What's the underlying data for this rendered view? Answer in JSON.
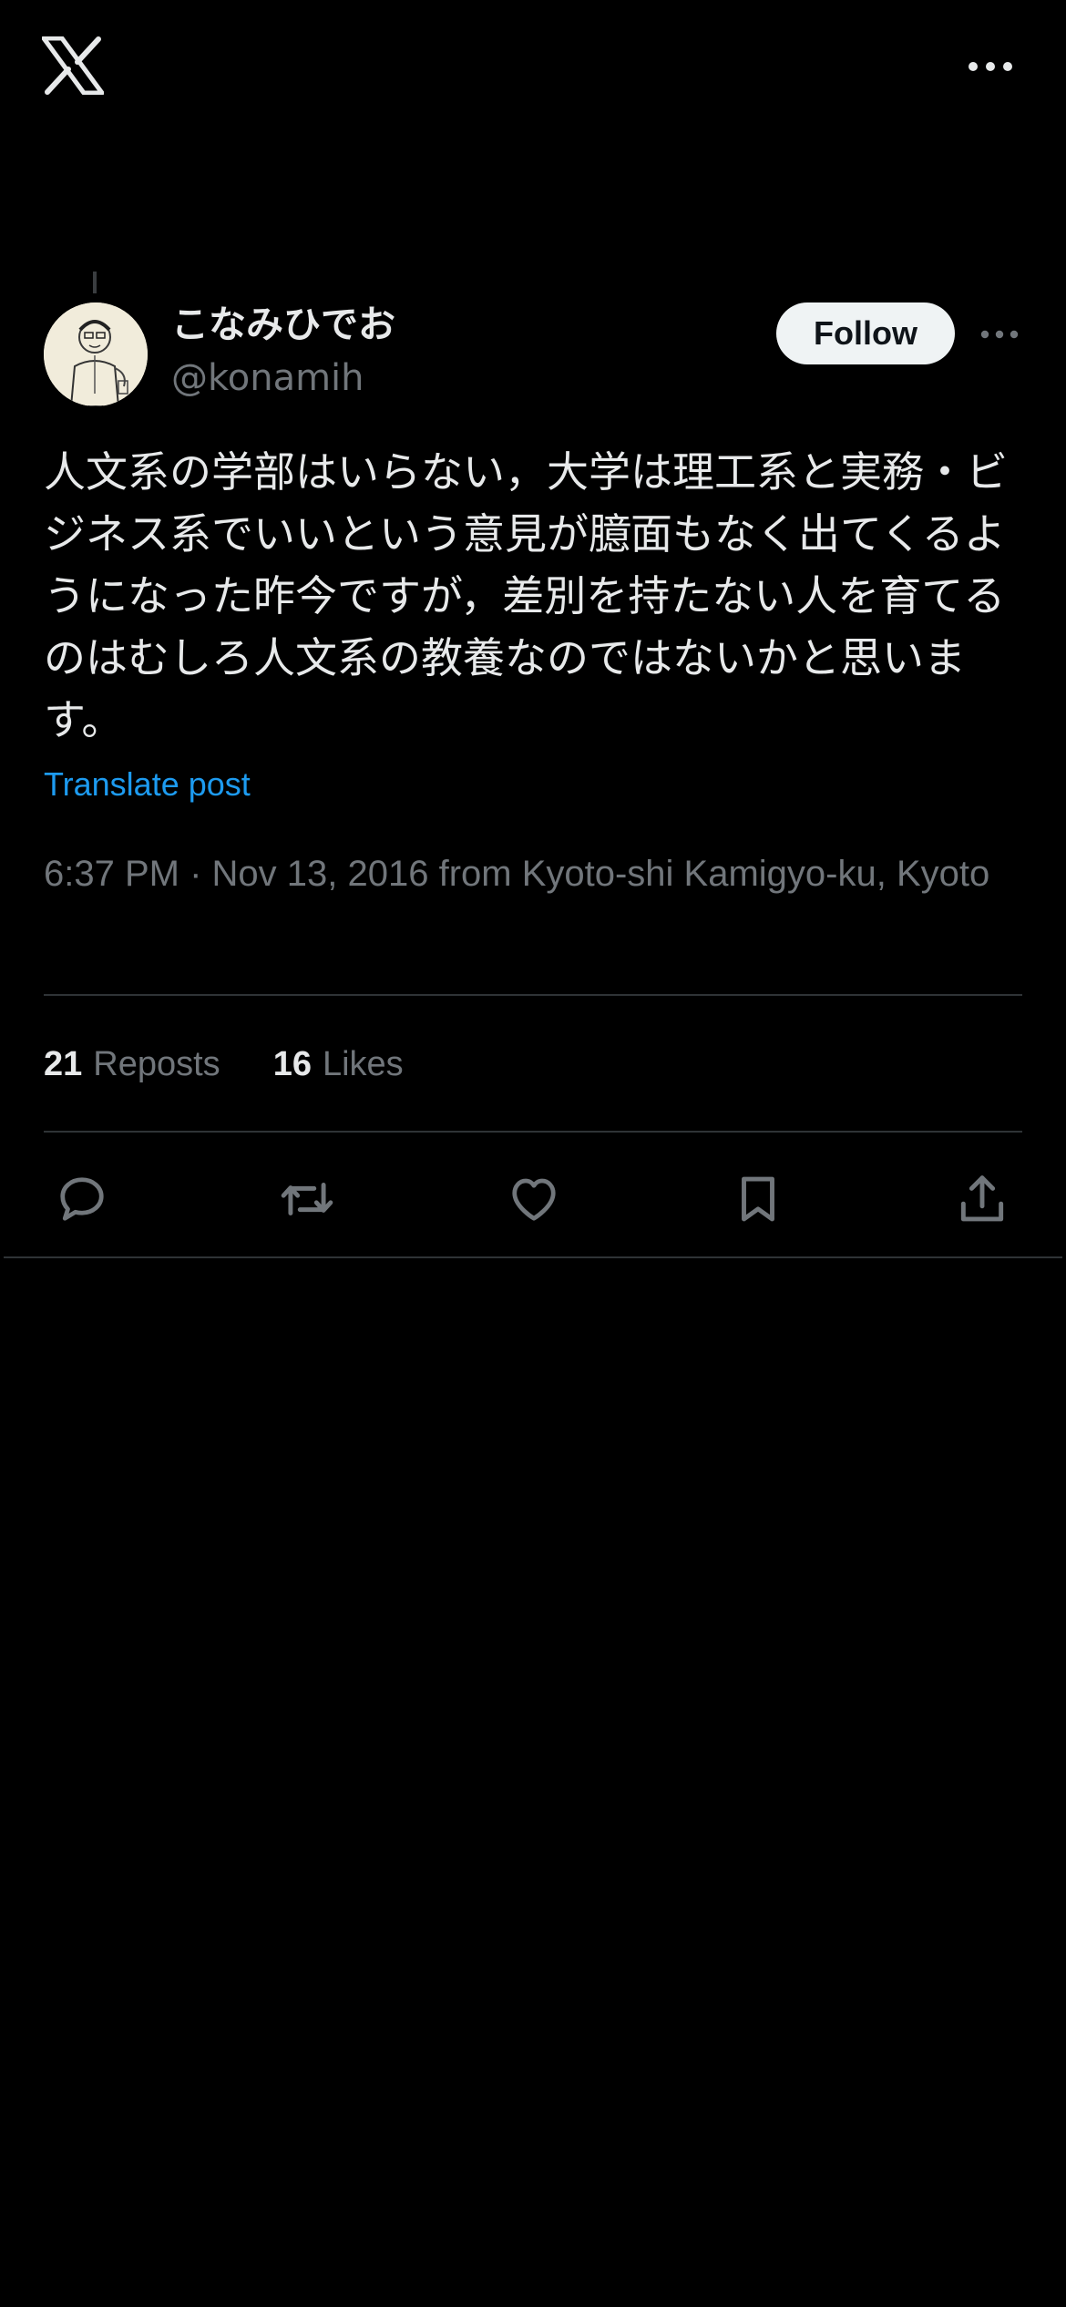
{
  "colors": {
    "background": "#000000",
    "text_primary": "#e7e9ea",
    "text_secondary": "#71767b",
    "link": "#1d9bf0",
    "follow_bg": "#eff3f4",
    "divider": "#2f3336"
  },
  "header": {
    "logo_icon": "x-logo-icon",
    "more_icon": "more-horizontal-icon"
  },
  "post": {
    "author": {
      "display_name": "こなみひでお",
      "handle": "@konamih",
      "avatar_icon": "avatar-sketch-portrait"
    },
    "follow_label": "Follow",
    "text": "人文系の学部はいらない，大学は理工系と実務・ビジネス系でいいという意見が臆面もなく出てくるようになった昨今ですが，差別を持たない人を育てるのはむしろ人文系の教養なのではないかと思います。",
    "translate_label": "Translate post",
    "timestamp": "6:37 PM · Nov 13, 2016 from Kyoto-shi Kamigyo-ku, Kyoto",
    "stats": {
      "reposts_count": "21",
      "reposts_label": "Reposts",
      "likes_count": "16",
      "likes_label": "Likes"
    },
    "actions": [
      {
        "icon": "reply-icon"
      },
      {
        "icon": "repost-icon"
      },
      {
        "icon": "like-icon"
      },
      {
        "icon": "bookmark-icon"
      },
      {
        "icon": "share-icon"
      }
    ]
  }
}
